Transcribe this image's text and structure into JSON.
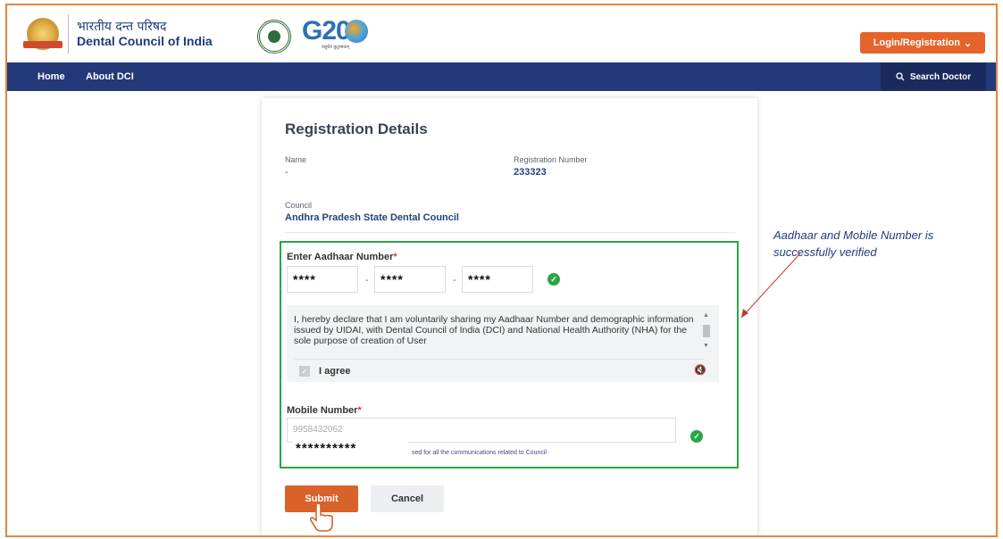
{
  "header": {
    "org_hindi": "भारतीय दन्त परिषद",
    "org_english": "Dental Council of India",
    "g20_text": "G20",
    "g20_sub": "वसुधैव कुटुम्बकम्",
    "login_button": "Login/Registration",
    "login_caret": "⌄"
  },
  "nav": {
    "items": [
      "Home",
      "About DCI"
    ],
    "search_label": "Search Doctor"
  },
  "card": {
    "title": "Registration Details",
    "name_label": "Name",
    "name_value": "-",
    "reg_label": "Registration Number",
    "reg_value": "233323",
    "council_label": "Council",
    "council_value": "Andhra Pradesh State Dental Council"
  },
  "aadhaar": {
    "label": "Enter Aadhaar Number",
    "required_mark": "*",
    "part1": "****",
    "part2": "****",
    "part3": "****",
    "dash": "-",
    "verified": true
  },
  "consent": {
    "text": "I, hereby declare that I am voluntarily sharing my Aadhaar Number and demographic information issued by UIDAI, with Dental Council of India (DCI) and National Health Authority (NHA) for the sole purpose of creation of User",
    "agree_label": "I agree",
    "agree_checked": true
  },
  "mobile": {
    "label": "Mobile Number",
    "required_mark": "*",
    "value": "9958432062",
    "masked": "**********",
    "help": "sed for all the communications related to Council",
    "verified": true
  },
  "actions": {
    "submit": "Submit",
    "cancel": "Cancel"
  },
  "annotation": {
    "text": "Aadhaar and Mobile Number is successfully verified"
  },
  "colors": {
    "nav": "#23397a",
    "accent": "#e5642b",
    "verified_border": "#28a745"
  }
}
